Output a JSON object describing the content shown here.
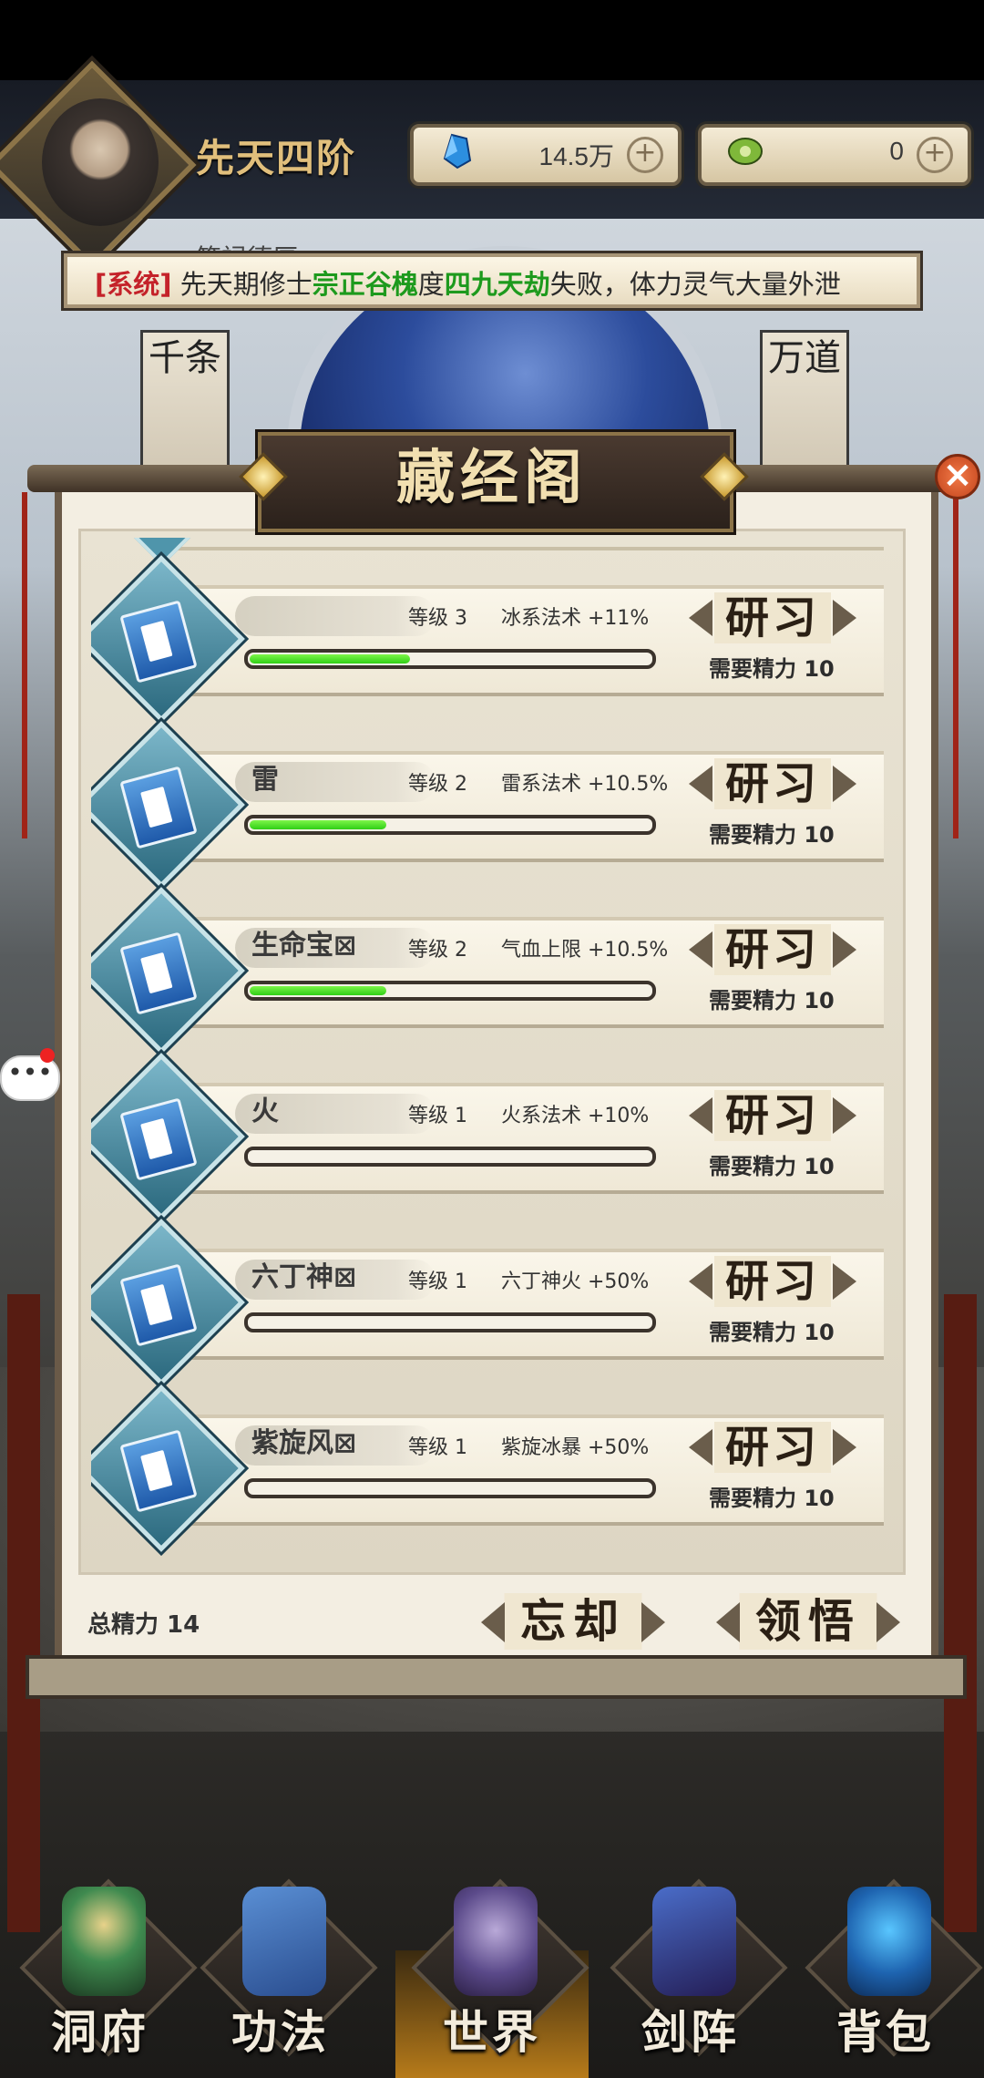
{
  "hud": {
    "rank": "先天四阶",
    "spirit_stones": "14.5万",
    "jade": "0",
    "plus": "+"
  },
  "notice": {
    "prefix": "[系统]",
    "part1": " 先天期修士",
    "name": "宗正谷槐",
    "part2": "度",
    "event": "四九天劫",
    "part3": "失败，体力灵气大量外泄",
    "faded_text": "签禄德厚"
  },
  "background": {
    "scroll_left": "千条",
    "scroll_right": "万道"
  },
  "panel": {
    "title": "藏经阁",
    "close": "×",
    "total_label": "总精力 14",
    "forget_label": "忘却",
    "comprehend_label": "领悟"
  },
  "skills": [
    {
      "name": "",
      "level": "等级 3",
      "bonus": "冰系法术 +11%",
      "progress": 0.4,
      "study": "研习",
      "need": "需要精力 10"
    },
    {
      "name": "雷",
      "level": "等级 2",
      "bonus": "雷系法术 +10.5%",
      "progress": 0.34,
      "study": "研习",
      "need": "需要精力 10"
    },
    {
      "name": "生命宝⊠",
      "level": "等级 2",
      "bonus": "气血上限 +10.5%",
      "progress": 0.34,
      "study": "研习",
      "need": "需要精力 10"
    },
    {
      "name": "火",
      "level": "等级 1",
      "bonus": "火系法术 +10%",
      "progress": 0,
      "study": "研习",
      "need": "需要精力 10"
    },
    {
      "name": "六丁神⊠",
      "level": "等级 1",
      "bonus": "六丁神火 +50%",
      "progress": 0,
      "study": "研习",
      "need": "需要精力 10"
    },
    {
      "name": "紫旋风⊠",
      "level": "等级 1",
      "bonus": "紫旋冰暴 +50%",
      "progress": 0,
      "study": "研习",
      "need": "需要精力 10"
    }
  ],
  "bubble": "•••",
  "nav": [
    {
      "label": "洞府",
      "icon": "cave-residence-icon"
    },
    {
      "label": "功法",
      "icon": "skill-books-icon"
    },
    {
      "label": "世界",
      "icon": "world-icon"
    },
    {
      "label": "剑阵",
      "icon": "sword-array-icon"
    },
    {
      "label": "背包",
      "icon": "backpack-icon"
    }
  ],
  "colors": {
    "accent_gold": "#e1bf7c",
    "system_red": "#c4222a",
    "highlight_green": "#1d9a1d",
    "progress_green": "#3fdc22"
  }
}
